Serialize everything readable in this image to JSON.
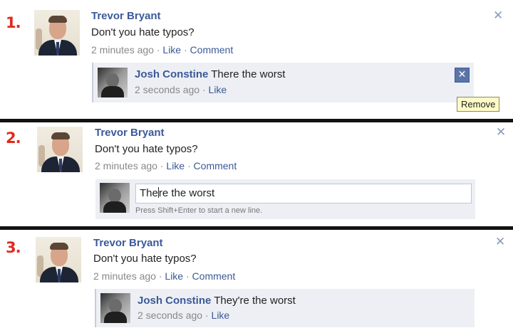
{
  "panels": [
    {
      "step": "1.",
      "post": {
        "author": "Trevor Bryant",
        "text": "Don't you hate typos?",
        "time": "2 minutes ago",
        "like": "Like",
        "comment": "Comment"
      },
      "comment": {
        "author": "Josh Constine",
        "text": "There the worst",
        "time": "2 seconds ago",
        "like": "Like"
      },
      "remove_tooltip": "Remove"
    },
    {
      "step": "2.",
      "post": {
        "author": "Trevor Bryant",
        "text": "Don't you hate typos?",
        "time": "2 minutes ago",
        "like": "Like",
        "comment": "Comment"
      },
      "edit": {
        "value_before_cursor": "The",
        "value_after_cursor": "re the worst",
        "hint": "Press Shift+Enter to start a new line."
      }
    },
    {
      "step": "3.",
      "post": {
        "author": "Trevor Bryant",
        "text": "Don't you hate typos?",
        "time": "2 minutes ago",
        "like": "Like",
        "comment": "Comment"
      },
      "comment": {
        "author": "Josh Constine",
        "text": "They're the worst",
        "time": "2 seconds ago",
        "like": "Like"
      }
    }
  ],
  "separator": " · ",
  "close_glyph": "✕",
  "remove_glyph": "✕",
  "colors": {
    "link": "#3b5998",
    "step_number": "#e02a1e",
    "comment_bg": "#edeff4",
    "tooltip_bg": "#fffbc7"
  }
}
